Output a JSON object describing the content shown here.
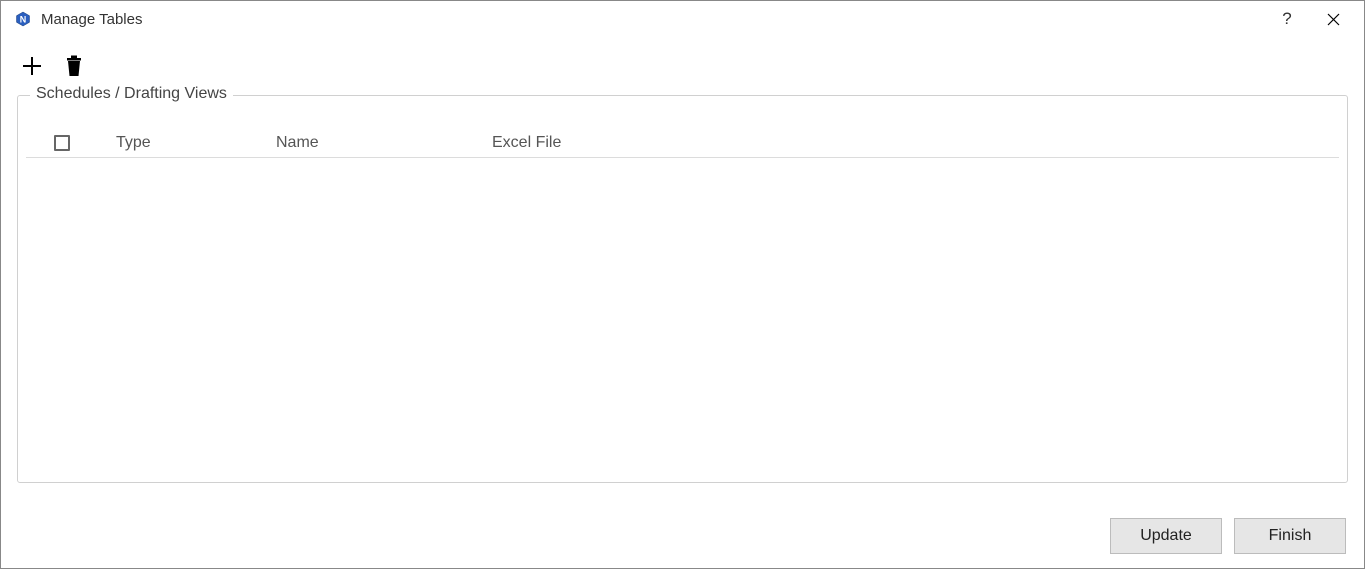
{
  "window": {
    "title": "Manage Tables"
  },
  "toolbar": {
    "add_tooltip": "Add",
    "delete_tooltip": "Delete"
  },
  "group": {
    "label": "Schedules / Drafting Views"
  },
  "table": {
    "headers": {
      "type": "Type",
      "name": "Name",
      "excel_file": "Excel File"
    },
    "rows": []
  },
  "buttons": {
    "update": "Update",
    "finish": "Finish"
  }
}
